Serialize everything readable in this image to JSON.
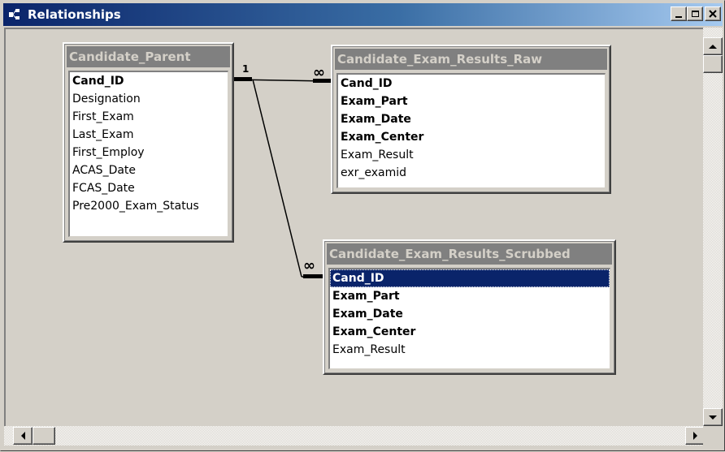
{
  "window": {
    "title": "Relationships"
  },
  "tables": [
    {
      "name": "Candidate_Parent",
      "fields": [
        {
          "label": "Cand_ID",
          "key": true
        },
        {
          "label": "Designation",
          "key": false
        },
        {
          "label": "First_Exam",
          "key": false
        },
        {
          "label": "Last_Exam",
          "key": false
        },
        {
          "label": "First_Employ",
          "key": false
        },
        {
          "label": "ACAS_Date",
          "key": false
        },
        {
          "label": "FCAS_Date",
          "key": false
        },
        {
          "label": "Pre2000_Exam_Status",
          "key": false
        }
      ]
    },
    {
      "name": "Candidate_Exam_Results_Raw",
      "fields": [
        {
          "label": "Cand_ID",
          "key": true
        },
        {
          "label": "Exam_Part",
          "key": true
        },
        {
          "label": "Exam_Date",
          "key": true
        },
        {
          "label": "Exam_Center",
          "key": true
        },
        {
          "label": "Exam_Result",
          "key": false
        },
        {
          "label": "exr_examid",
          "key": false
        }
      ]
    },
    {
      "name": "Candidate_Exam_Results_Scrubbed",
      "fields": [
        {
          "label": "Cand_ID",
          "key": true,
          "selected": true
        },
        {
          "label": "Exam_Part",
          "key": true
        },
        {
          "label": "Exam_Date",
          "key": true
        },
        {
          "label": "Exam_Center",
          "key": true
        },
        {
          "label": "Exam_Result",
          "key": false
        }
      ]
    }
  ],
  "relationships": [
    {
      "one_label": "1",
      "many_label": "∞",
      "from": "Candidate_Parent.Cand_ID",
      "to": "Candidate_Exam_Results_Raw.Cand_ID"
    },
    {
      "one_label": "1",
      "many_label": "∞",
      "from": "Candidate_Parent.Cand_ID",
      "to": "Candidate_Exam_Results_Scrubbed.Cand_ID"
    }
  ],
  "colors": {
    "titlebar_start": "#0a246a",
    "titlebar_end": "#a6caf0",
    "table_header": "#808080",
    "selection": "#0a246a",
    "background": "#d4d0c8"
  }
}
